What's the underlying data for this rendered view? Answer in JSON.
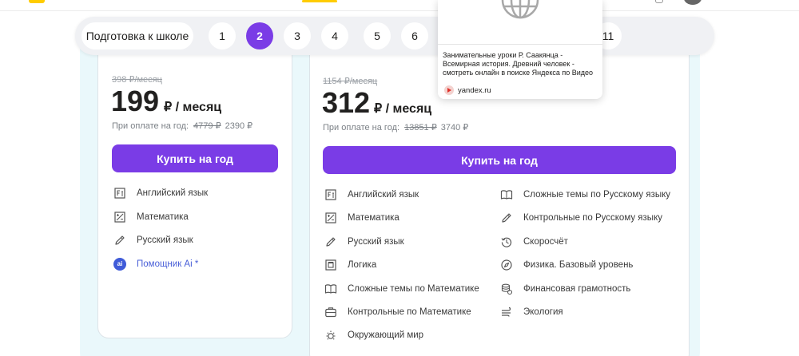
{
  "grades_bar": {
    "preschool_label": "Подготовка к школе",
    "grades": [
      "1",
      "2",
      "3",
      "4",
      "5",
      "6"
    ],
    "active_grade": "2",
    "last_grade": "11"
  },
  "tooltip": {
    "description": "Занимательные уроки Р. Саакянца - Всемирная история. Древний человек - смотреть онлайн в поиске Яндекса по Видео",
    "source": "yandex.ru",
    "thumbnail_icon": "globe-icon",
    "source_icon": "play-icon"
  },
  "plans": [
    {
      "old_price": "398 ₽/месяц",
      "price": "199",
      "unit": "₽ / месяц",
      "year_prefix": "При оплате на год:",
      "year_old": "4779 ₽",
      "year_now": "2390 ₽",
      "buy_label": "Купить на год",
      "ribbon_color": "#ffe14a",
      "features": [
        {
          "label": "Английский язык",
          "icon": "english-icon"
        },
        {
          "label": "Математика",
          "icon": "math-icon"
        },
        {
          "label": "Русский язык",
          "icon": "pencil-icon"
        },
        {
          "label": "Помощник Ai *",
          "icon": "ai-icon",
          "badge": "ai"
        }
      ]
    },
    {
      "old_price": "1154 ₽/месяц",
      "price": "312",
      "unit": "₽ / месяц",
      "year_prefix": "При оплате на год:",
      "year_old": "13851 ₽",
      "year_now": "3740 ₽",
      "buy_label": "Купить на год",
      "ribbon_color": "#ffe14a",
      "ribbon2_color": "#e8154a",
      "features_left": [
        {
          "label": "Английский язык",
          "icon": "english-icon"
        },
        {
          "label": "Математика",
          "icon": "math-icon"
        },
        {
          "label": "Русский язык",
          "icon": "pencil-icon"
        },
        {
          "label": "Логика",
          "icon": "logic-icon"
        },
        {
          "label": "Сложные темы по Математике",
          "icon": "book-icon"
        },
        {
          "label": "Контрольные по Математике",
          "icon": "briefcase-icon"
        },
        {
          "label": "Окружающий мир",
          "icon": "sun-icon"
        }
      ],
      "features_right": [
        {
          "label": "Сложные темы по Русскому языку",
          "icon": "book-icon"
        },
        {
          "label": "Контрольные по Русскому языку",
          "icon": "pencil-icon"
        },
        {
          "label": "Скоросчёт",
          "icon": "history-icon"
        },
        {
          "label": "Физика. Базовый уровень",
          "icon": "compass-icon"
        },
        {
          "label": "Финансовая грамотность",
          "icon": "coins-icon"
        },
        {
          "label": "Экология",
          "icon": "wind-icon"
        }
      ]
    }
  ],
  "colors": {
    "accent": "#7a3ce6",
    "panel_bg": "#eaf8fb",
    "ai_blue": "#3f5bd8"
  }
}
